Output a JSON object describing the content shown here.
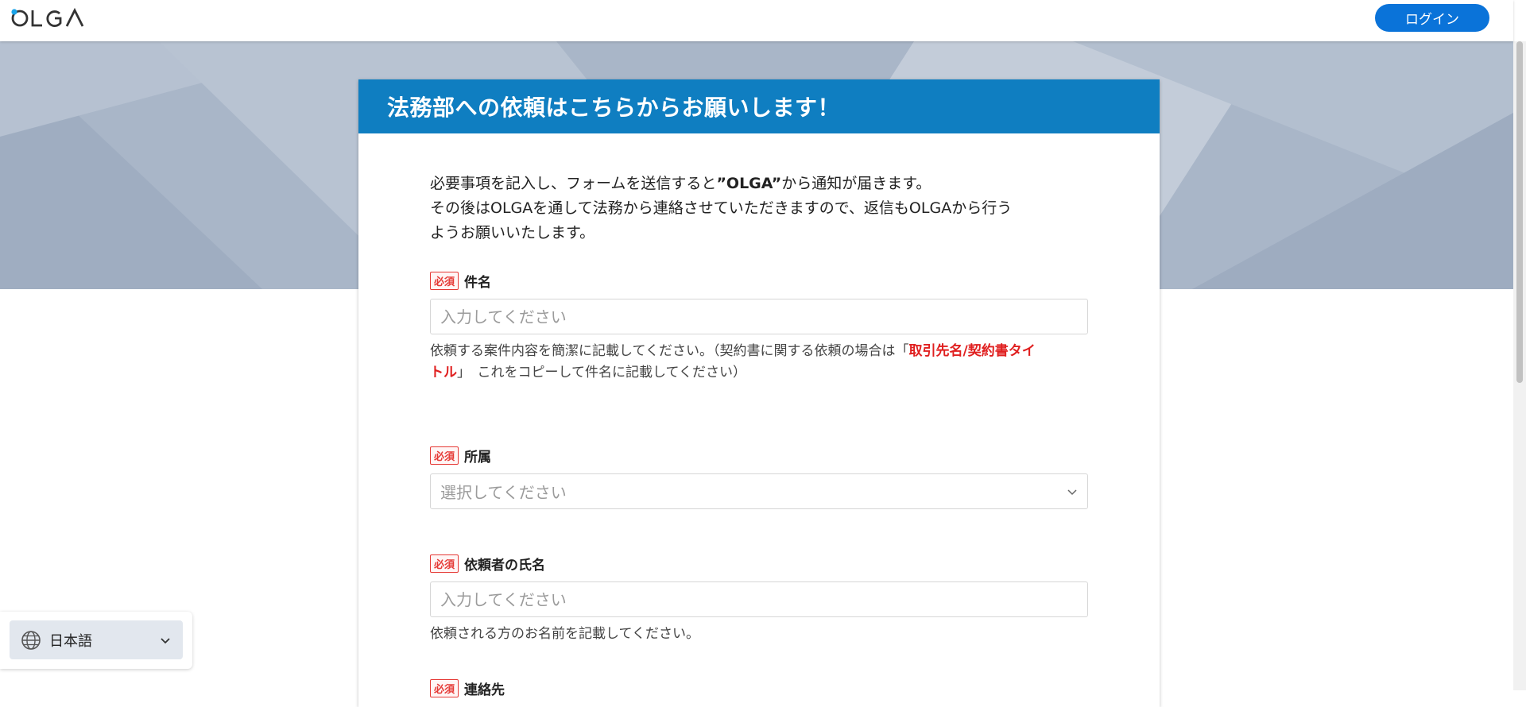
{
  "header": {
    "logo_text": "OLGA",
    "login_label": "ログイン"
  },
  "form": {
    "title": "法務部への依頼はこちらからお願いします！",
    "intro_line1_pre": "必要事項を記入し、フォームを送信すると",
    "intro_line1_brand": "”OLGA”",
    "intro_line1_post": "から通知が届きます。",
    "intro_line2": "その後はOLGAを通して法務から連絡させていただきますので、返信もOLGAから行う",
    "intro_line3": "ようお願いいたします。",
    "required_badge": "必須",
    "fields": [
      {
        "label": "件名",
        "placeholder": "入力してください",
        "hint_pre": "依頼する案件内容を簡潔に記載してください。（契約書に関する依頼の場合は「",
        "hint_red_1": "取引先名/契約書タイ",
        "hint_red_2": "トル",
        "hint_post": "」　これをコピーして件名に記載してください）"
      },
      {
        "label": "所属",
        "placeholder": "選択してください"
      },
      {
        "label": "依頼者の氏名",
        "placeholder": "入力してください",
        "hint": "依頼される方のお名前を記載してください。"
      },
      {
        "label": "連絡先"
      }
    ]
  },
  "language": {
    "current": "日本語"
  },
  "colors": {
    "primary": "#0a73d9",
    "header_bar": "#0f7ec1",
    "required": "#e53935",
    "banner": "#aab7c9"
  }
}
